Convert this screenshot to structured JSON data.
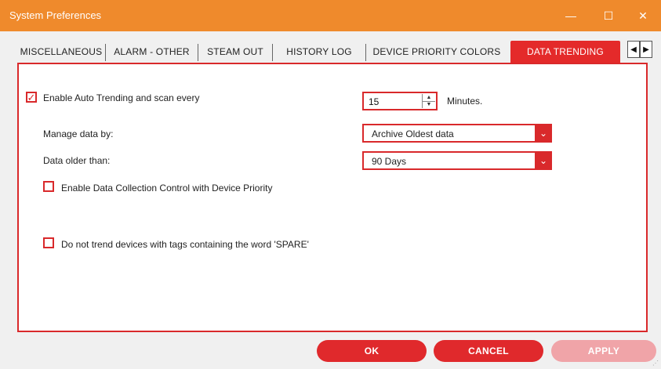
{
  "window": {
    "title": "System Preferences",
    "controls": {
      "minimize": "—",
      "maximize": "☐",
      "close": "✕"
    }
  },
  "tabs": [
    {
      "label": "MISCELLANEOUS",
      "active": false
    },
    {
      "label": "ALARM - OTHER",
      "active": false
    },
    {
      "label": "STEAM OUT",
      "active": false
    },
    {
      "label": "HISTORY LOG",
      "active": false
    },
    {
      "label": "DEVICE PRIORITY COLORS",
      "active": false
    },
    {
      "label": "DATA TRENDING",
      "active": true
    }
  ],
  "tab_scroll": {
    "left": "◀",
    "right": "▶"
  },
  "trending": {
    "enable_auto_trending": {
      "label": "Enable Auto Trending and scan every",
      "checked": true
    },
    "scan_interval": {
      "value": "15",
      "unit": "Minutes."
    },
    "manage_by": {
      "label": "Manage data by:",
      "value": "Archive Oldest data"
    },
    "older_than": {
      "label": "Data older than:",
      "value": "90 Days"
    },
    "collection_control": {
      "label": "Enable Data Collection Control with Device Priority",
      "checked": false
    },
    "skip_spare": {
      "label": "Do not trend devices with tags containing the word 'SPARE'",
      "checked": false
    }
  },
  "buttons": {
    "ok": "OK",
    "cancel": "CANCEL",
    "apply": "APPLY"
  },
  "colors": {
    "titlebar": "#ef8a2c",
    "accent": "#e0292c",
    "disabled": "#f0a4a8"
  }
}
